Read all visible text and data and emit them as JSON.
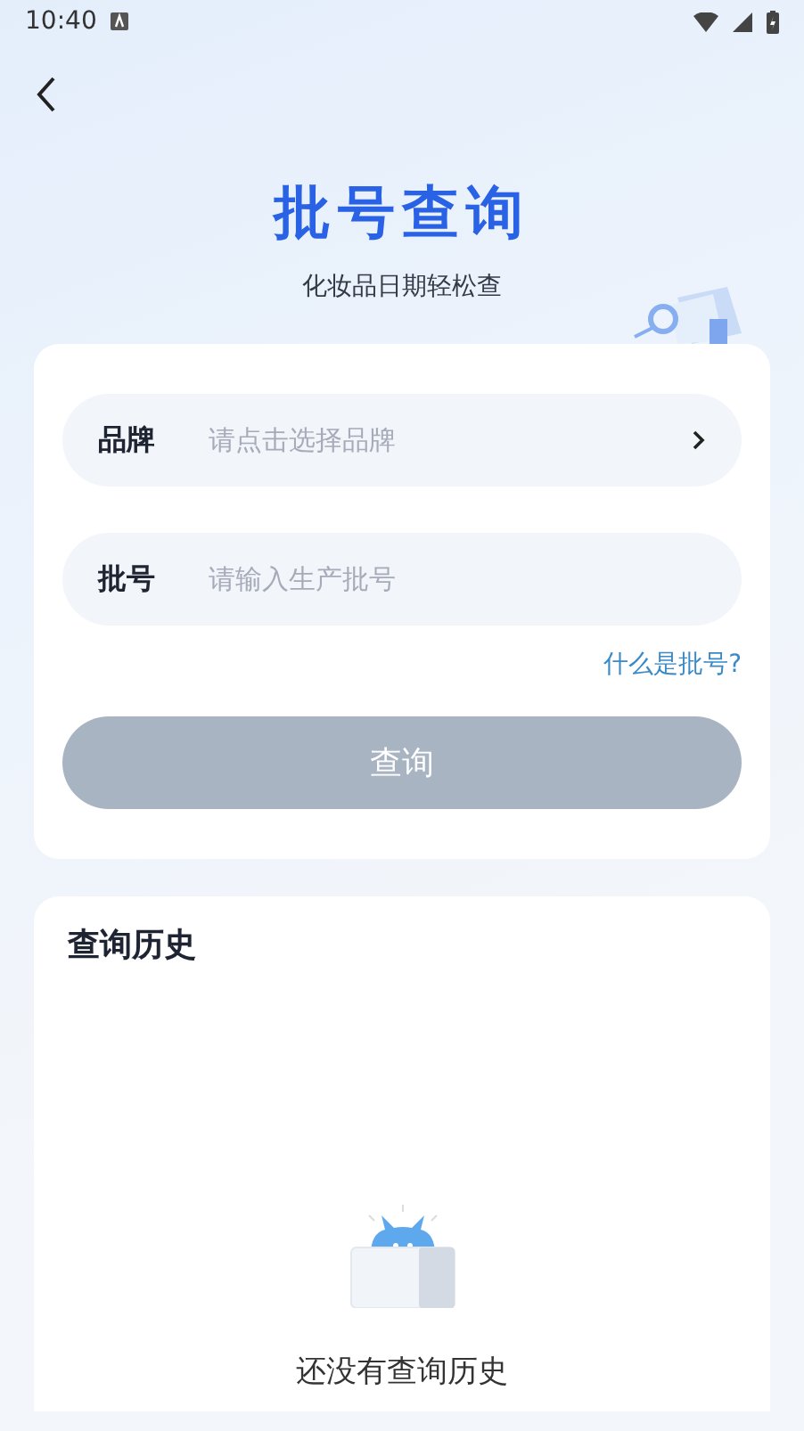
{
  "status_bar": {
    "time": "10:40"
  },
  "header": {
    "title": "批号查询",
    "subtitle": "化妆品日期轻松查"
  },
  "form": {
    "fields": [
      {
        "kind": "select",
        "label": "品牌",
        "placeholder": "请点击选择品牌"
      },
      {
        "kind": "input",
        "label": "批号",
        "placeholder": "请输入生产批号"
      }
    ],
    "help_link": "什么是批号?",
    "submit": {
      "label": "查询",
      "disabled": true
    }
  },
  "history": {
    "title": "查询历史",
    "empty_text": "还没有查询历史"
  }
}
